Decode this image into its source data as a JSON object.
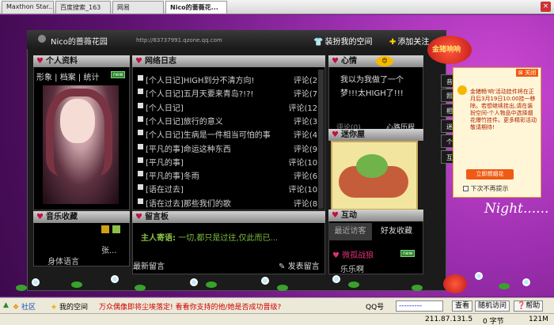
{
  "tabs": [
    "Maxthon Star...",
    "百度搜索_163",
    "网易",
    "Nico的蔷薇花..."
  ],
  "active_tab": 3,
  "site": {
    "title": "Nico的蔷薇花园",
    "url": "http://83737991.qzone.qq.com",
    "dress_link": "装扮我的空间",
    "follow_link": "添加关注"
  },
  "profile": {
    "header": "个人资料",
    "tabs": "形象 | 档案 | 统计",
    "new_badge": "new"
  },
  "blog": {
    "header": "网络日志",
    "rows": [
      {
        "title": "[个人日记]HIGH到分不清方向!",
        "count": "评论(2)"
      },
      {
        "title": "[个人日记]五月天要来青岛?!?!",
        "count": "评论(7)"
      },
      {
        "title": "[个人日记]",
        "count": "评论(12)"
      },
      {
        "title": "[个人日记]旅行的意义",
        "count": "评论(3)"
      },
      {
        "title": "[个人日记]生病是一件相当可怕的事",
        "count": "评论(4)"
      },
      {
        "title": "[平凡的事]命运这种东西",
        "count": "评论(9)"
      },
      {
        "title": "[平凡的事]",
        "count": "评论(10)"
      },
      {
        "title": "[平凡的事]冬雨",
        "count": "评论(6)"
      },
      {
        "title": "[语在过去]",
        "count": "评论(10)"
      },
      {
        "title": "[语在过去]那些我们的歌",
        "count": "评论(8)"
      }
    ]
  },
  "mood": {
    "header": "心情",
    "text": "我以为我做了一个梦!!!太HIGH了!!!",
    "comment": "评论(0)",
    "history": "心路历程"
  },
  "room": {
    "header": "迷你屋"
  },
  "music": {
    "header": "音乐收藏",
    "line1": "张...",
    "line2": "身体语言"
  },
  "guestbook": {
    "header": "留言板",
    "host_label": "主人寄语:",
    "host_text": "一切,都只是过往,仅此而已...",
    "latest": "最新留言",
    "post_btn": "发表留言"
  },
  "interact": {
    "header": "互动",
    "tab1": "最近访客",
    "tab2": "好友收藏",
    "item1": "微孤战狼",
    "item2": "乐乐啊"
  },
  "right_labels": [
    "音",
    "照",
    "相",
    "迷",
    "个",
    "互"
  ],
  "ad": {
    "close": "关闭",
    "text": "金猪畅'响'活动挂件将在正月后3月19日10:00挂一移除。若想继续挂出,请在装扮空间-个人物品中选择烟花爆竹挂件。更多精彩活动敬请期待!",
    "button": "立即燃烟花",
    "checkbox": "下次不再提示",
    "banner": "金猪响响"
  },
  "decor": {
    "night_text": "Night......"
  },
  "statusbar": {
    "community": "社区",
    "my_space": "我的空间",
    "marquee": "万众偶像即将尘埃落定! 看看你支持的他/她是否成功晋级?",
    "qq_label": "QQ号",
    "qq_placeholder": "---------",
    "view_btn": "查看",
    "random_btn": "随机访问",
    "help_btn": "帮助"
  },
  "winbar": {
    "ip": "211.87.131.5",
    "bytes": "0 字节",
    "speed": "121M"
  },
  "colors": {
    "accent": "#c01040",
    "bg_purple": "#9d2fb0",
    "link_green": "#7fbf3f"
  }
}
